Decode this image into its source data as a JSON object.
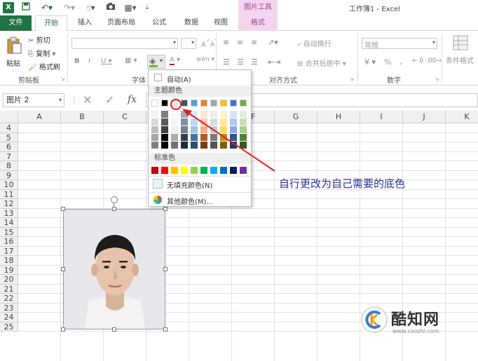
{
  "titlebar": {
    "window_title": "工作簿1 - Excel",
    "picture_tools": "图片工具",
    "qat": [
      "save-icon",
      "undo-icon",
      "redo-icon",
      "touch-icon",
      "camera-icon",
      "layout-icon"
    ]
  },
  "tabs": {
    "file": "文件",
    "home": "开始",
    "insert": "插入",
    "page_layout": "页面布局",
    "formulas": "公式",
    "data": "数据",
    "view": "视图",
    "format": "格式"
  },
  "ribbon": {
    "clipboard": {
      "paste": "粘贴",
      "cut": "剪切",
      "copy": "复制",
      "format_painter": "格式刷",
      "label": "剪贴板"
    },
    "font": {
      "label": "字体",
      "bold": "B",
      "italic": "I",
      "underline": "U",
      "grow": "A",
      "shrink": "A",
      "font_color": "A"
    },
    "alignment": {
      "wrap": "自动换行",
      "merge": "合并后居中",
      "label": "对齐方式"
    },
    "number": {
      "format": "常规",
      "percent": "%",
      "comma": ",",
      "label": "数字"
    },
    "styles": {
      "conditional": "条件格式"
    }
  },
  "formula_bar": {
    "name_box": "图片 2",
    "cancel": "✕",
    "confirm": "✓",
    "fx": "fx"
  },
  "grid": {
    "columns": [
      "A",
      "B",
      "C",
      "D",
      "E",
      "F",
      "G",
      "H",
      "I",
      "J",
      "K"
    ],
    "rows": [
      "4",
      "5",
      "6",
      "7",
      "8",
      "9",
      "10",
      "11",
      "12",
      "13",
      "14",
      "15",
      "16",
      "17",
      "18",
      "19",
      "20",
      "21",
      "22",
      "23",
      "24",
      "25"
    ]
  },
  "dropdown": {
    "automatic": "自动(A)",
    "theme_header": "主题颜色",
    "standard_header": "标准色",
    "no_fill": "无填充颜色(N)",
    "more_colors": "其他颜色(M)...",
    "theme_colors": [
      "#ffffff",
      "#000000",
      "#e7e6e6",
      "#44546a",
      "#5b9bd5",
      "#ed7d31",
      "#a5a5a5",
      "#ffc000",
      "#4472c4",
      "#70ad47"
    ],
    "standard_colors": [
      "#c00000",
      "#ff0000",
      "#ffc000",
      "#ffff00",
      "#92d050",
      "#00b050",
      "#00b0f0",
      "#0070c0",
      "#002060",
      "#7030a0"
    ]
  },
  "annotation": {
    "text": "自行更改为自己需要的底色"
  },
  "watermark": {
    "brand": "酷知网",
    "url": "www.coozhi.com"
  },
  "colors": {
    "excel_green": "#217346",
    "format_tab": "#a0418c",
    "annotation_red": "#e02020"
  }
}
